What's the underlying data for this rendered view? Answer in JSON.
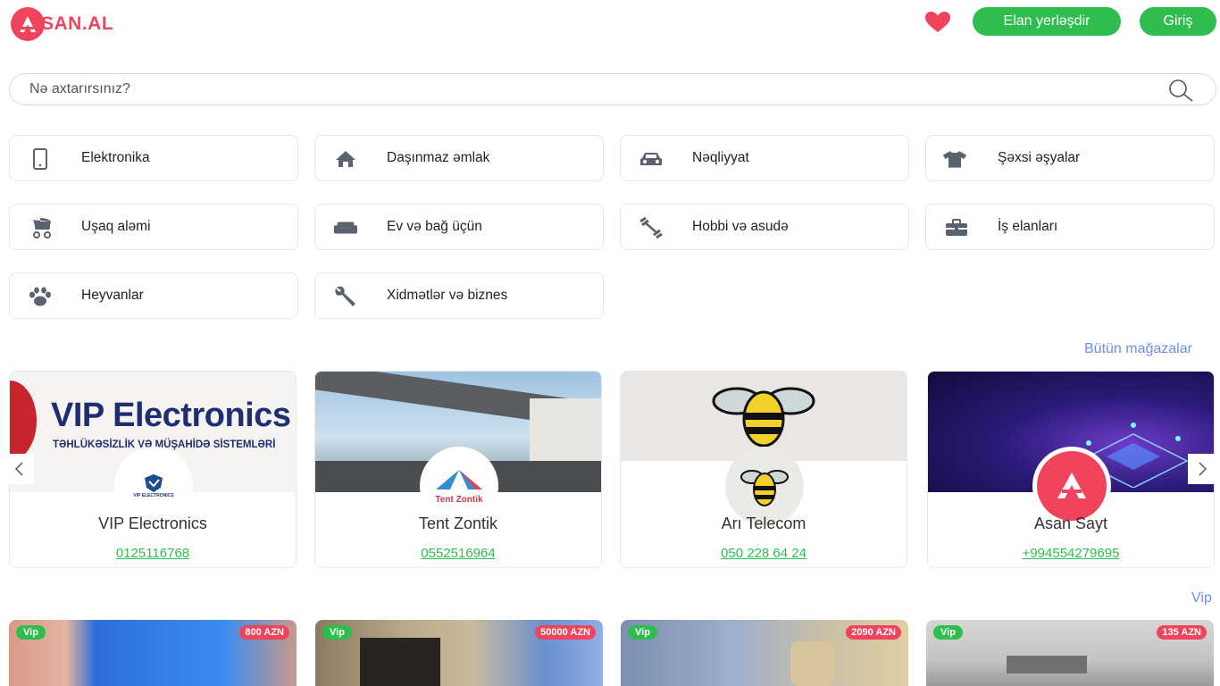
{
  "brand": {
    "logo_text": "SAN.AL",
    "accent_color": "#f0445d",
    "green_color": "#2ebd4e"
  },
  "header": {
    "post_button": "Elan yerləşdir",
    "login_button": "Giriş",
    "favorites_icon": "heart-icon"
  },
  "search": {
    "placeholder": "Nə axtarırsınız?",
    "icon": "search-icon"
  },
  "categories": [
    {
      "label": "Elektronika",
      "icon": "phone-icon"
    },
    {
      "label": "Daşınmaz əmlak",
      "icon": "home-icon"
    },
    {
      "label": "Nəqliyyat",
      "icon": "car-icon"
    },
    {
      "label": "Şəxsi əşyalar",
      "icon": "shirt-icon"
    },
    {
      "label": "Uşaq aləmi",
      "icon": "stroller-icon"
    },
    {
      "label": "Ev və bağ üçün",
      "icon": "sofa-icon"
    },
    {
      "label": "Hobbi və asudə",
      "icon": "dumbbell-icon"
    },
    {
      "label": "İş elanları",
      "icon": "briefcase-icon"
    },
    {
      "label": "Heyvanlar",
      "icon": "paw-icon"
    },
    {
      "label": "Xidmətlər və biznes",
      "icon": "wrench-icon"
    }
  ],
  "stores_section": {
    "all_stores_link": "Bütün mağazalar",
    "stores": [
      {
        "name": "VIP Electronics",
        "phone": "0125116768",
        "banner_title": "VIP Electronics",
        "banner_subtitle": "TƏHLÜKƏSİZLİK VƏ MÜŞAHİDƏ SİSTEMLƏRİ",
        "avatar_text": "VIP ELECTRONICS"
      },
      {
        "name": "Tent Zontik",
        "phone": "0552516964",
        "avatar_text": "Tent Zontik"
      },
      {
        "name": "Arı Telecom",
        "phone": "050 228 64 24"
      },
      {
        "name": "Asan Sayt",
        "phone": "+994554279695"
      }
    ]
  },
  "vip_section": {
    "link": "Vip",
    "listings": [
      {
        "badge": "Vip",
        "price": "800 AZN"
      },
      {
        "badge": "Vip",
        "price": "50000 AZN"
      },
      {
        "badge": "Vip",
        "price": "2090 AZN"
      },
      {
        "badge": "Vip",
        "price": "135 AZN"
      }
    ]
  }
}
